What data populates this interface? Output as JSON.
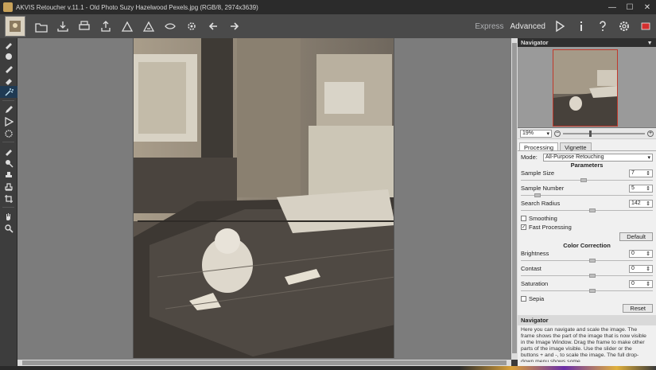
{
  "window": {
    "title": "AKVIS Retoucher v.11.1 - Old Photo Suzy Hazelwood Pexels.jpg (RGB/8, 2974x3639)",
    "minimize": "—",
    "maximize": "☐",
    "close": "✕"
  },
  "toolbar": {
    "express_label": "Express",
    "advanced_label": "Advanced"
  },
  "navigator": {
    "title": "Navigator",
    "zoom_value": "19%"
  },
  "tabs": [
    "Processing",
    "Vignette"
  ],
  "processing": {
    "mode_label": "Mode:",
    "mode_value": "All-Purpose Retouching",
    "parameters_title": "Parameters",
    "sample_size_label": "Sample Size",
    "sample_size_value": "7",
    "sample_number_label": "Sample Number",
    "sample_number_value": "5",
    "search_radius_label": "Search Radius",
    "search_radius_value": "142",
    "smoothing_label": "Smoothing",
    "smoothing_checked": false,
    "fast_processing_label": "Fast Processing",
    "fast_processing_checked": true,
    "default_label": "Default",
    "color_correction_title": "Color Correction",
    "brightness_label": "Brightness",
    "brightness_value": "0",
    "contrast_label": "Contast",
    "contrast_value": "0",
    "saturation_label": "Saturation",
    "saturation_value": "0",
    "sepia_label": "Sepia",
    "sepia_checked": false,
    "reset_label": "Reset"
  },
  "help": {
    "title": "Navigator",
    "text": "Here you can navigate and scale the image. The frame shows the part of the image that is now visible in the Image Window. Drag the frame to make other parts of the image visible. Use the slider or the buttons + and -, to scale the image. The full drop-down menu shows some"
  },
  "colors": {
    "accent": "#1f3a53",
    "nav_frame": "#c0392b"
  }
}
